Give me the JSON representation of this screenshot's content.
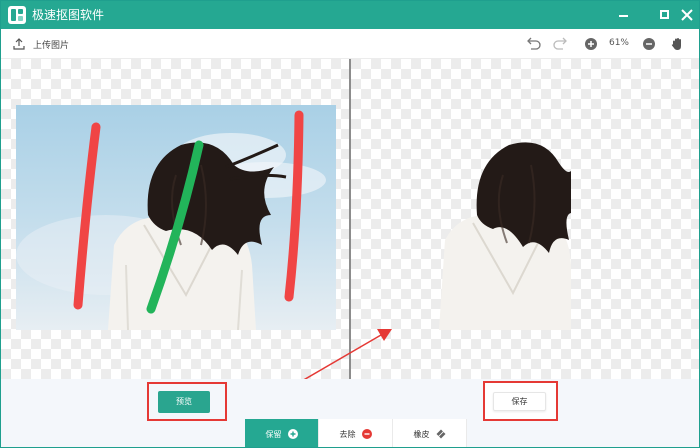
{
  "app": {
    "title": "极速抠图软件"
  },
  "toolbar": {
    "upload_label": "上传图片",
    "zoom_value": "61%"
  },
  "actions": {
    "preview_label": "预览",
    "save_label": "保存"
  },
  "modes": [
    {
      "label": "保留",
      "icon": "plus-circle-icon",
      "active": true
    },
    {
      "label": "去除",
      "icon": "minus-circle-icon",
      "active": false
    },
    {
      "label": "橡皮",
      "icon": "eraser-icon",
      "active": false
    }
  ],
  "colors": {
    "brand": "#25a892",
    "keep_stroke": "#22b45a",
    "remove_stroke": "#f04545",
    "highlight": "#e53935"
  }
}
